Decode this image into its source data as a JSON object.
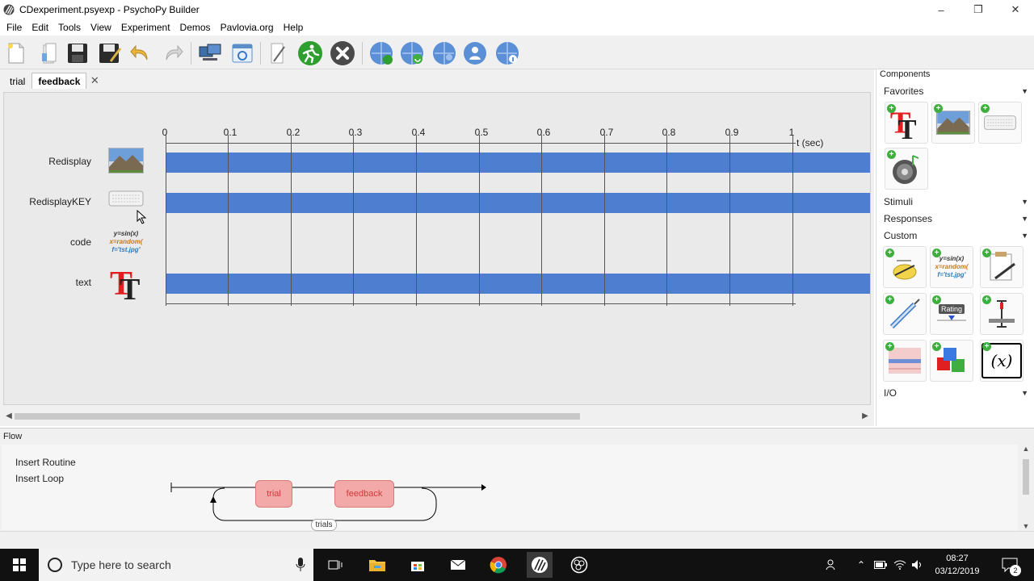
{
  "window": {
    "title": "CDexperiment.psyexp - PsychoPy Builder",
    "minimize": "–",
    "maximize": "❐",
    "close": "✕"
  },
  "menu": [
    "File",
    "Edit",
    "Tools",
    "View",
    "Experiment",
    "Demos",
    "Pavlovia.org",
    "Help"
  ],
  "toolbar": {
    "icons": [
      "new-file-icon",
      "open-file-icon",
      "save-icon",
      "save-as-icon",
      "undo-icon",
      "redo-icon",
      "monitor-center-icon",
      "experiment-settings-icon",
      "compile-script-icon",
      "run-icon",
      "stop-icon",
      "pavlovia-sync-icon",
      "pavlovia-search-icon",
      "pavlovia-user-icon",
      "pavlovia-info-icon",
      "pavlovia-project-icon"
    ]
  },
  "routine_tabs": [
    {
      "label": "trial",
      "active": false
    },
    {
      "label": "feedback",
      "active": true
    }
  ],
  "tab_close": "✕",
  "timeline": {
    "ticks": [
      "0",
      "0.1",
      "0.2",
      "0.3",
      "0.4",
      "0.5",
      "0.6",
      "0.7",
      "0.8",
      "0.9",
      "1"
    ],
    "unit": "t (sec)",
    "components": [
      {
        "name": "Redisplay",
        "icon": "image-icon",
        "has_bar": true
      },
      {
        "name": "RedisplayKEY",
        "icon": "keyboard-icon",
        "has_bar": true
      },
      {
        "name": "code",
        "icon": "code-icon",
        "has_bar": false
      },
      {
        "name": "text",
        "icon": "text-icon",
        "has_bar": true
      }
    ],
    "code_icon_lines": [
      "y=sin(x)",
      "x=random(",
      "f='tst.jpg'"
    ]
  },
  "components_panel": {
    "title": "Components",
    "categories": [
      "Favorites",
      "Stimuli",
      "Responses",
      "Custom",
      "I/O"
    ],
    "rating_label": "Rating",
    "variable_label": "(x)"
  },
  "flow": {
    "title": "Flow",
    "insert_routine": "Insert Routine",
    "insert_loop": "Insert Loop",
    "routines": [
      "trial",
      "feedback"
    ],
    "loop_name": "trials"
  },
  "taskbar": {
    "search_placeholder": "Type here to search",
    "time": "08:27",
    "date": "03/12/2019",
    "notification_count": "2"
  },
  "colors": {
    "bar": "#4d7ed0",
    "routine_box": "#f4a9a9",
    "routine_text": "#d03a3a",
    "run_green": "#2e9e2e"
  }
}
